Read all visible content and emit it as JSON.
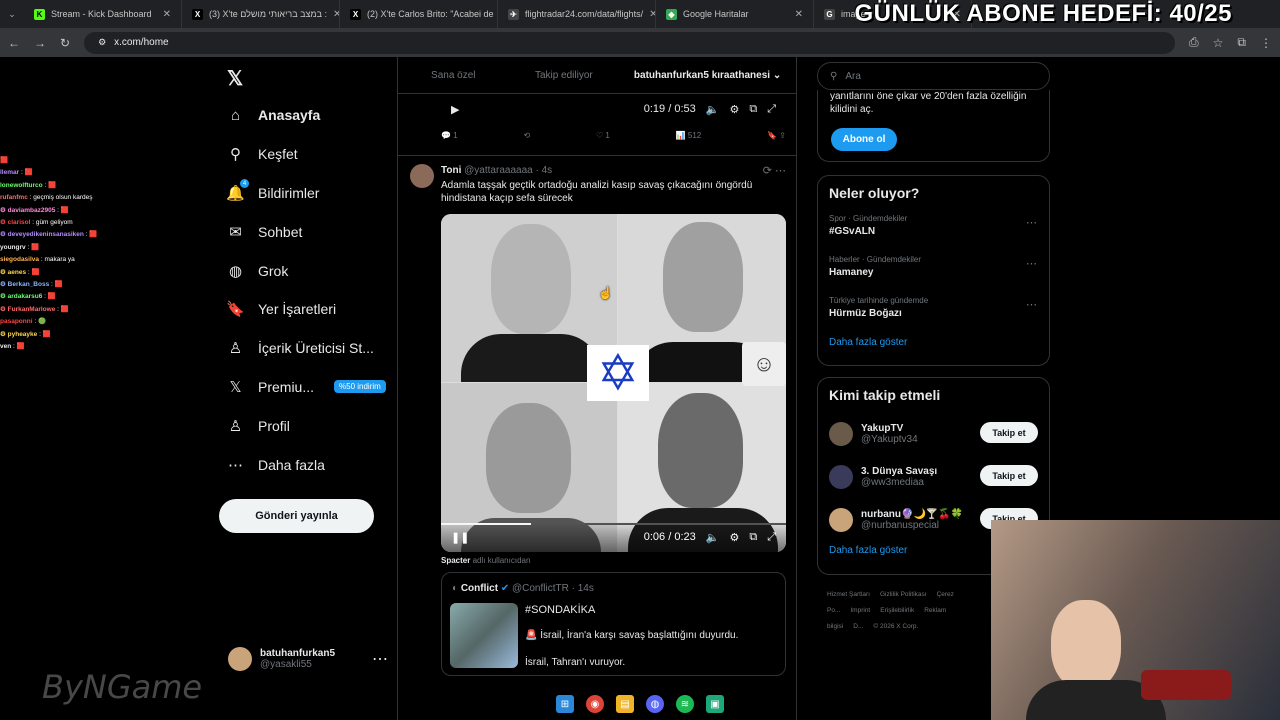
{
  "tabs": [
    {
      "title": "Stream - Kick Dashboard",
      "fav": "K",
      "color": "#53fc18"
    },
    {
      "title": "(3) X'te במצב בריאותי מושלם :",
      "fav": "X",
      "color": "#000"
    },
    {
      "title": "(2) X'te Carlos Brito: \"Acabei de",
      "fav": "X",
      "color": "#000"
    },
    {
      "title": "flightradar24.com/data/flights/",
      "fav": "✈",
      "color": "#444"
    },
    {
      "title": "Google Haritalar",
      "fav": "◆",
      "color": "#34a853"
    },
    {
      "title": "image",
      "fav": "G",
      "color": "#444"
    }
  ],
  "address": {
    "url": "x.com/home"
  },
  "overlay": "GÜNLÜK ABONE HEDEFİ: 40/25",
  "chat": [
    {
      "user": "",
      "msg": "🟥",
      "color": "#ff6a6a"
    },
    {
      "user": "llemar",
      "msg": ": 🟥",
      "color": "#b08cff"
    },
    {
      "user": "lonewolfturco",
      "msg": ": 🟥",
      "color": "#6aff6a"
    },
    {
      "user": "rufanfmc",
      "msg": ": geçmiş olsun kardeş",
      "color": "#ff6a6a"
    },
    {
      "user": "⚙ daviambaz2905",
      "msg": ": 🟥",
      "color": "#ff8ad8"
    },
    {
      "user": "⚙ clarisol",
      "msg": ": güm geliyom",
      "color": "#ff4444"
    },
    {
      "user": "⚙ deveyedikeninsanasiken",
      "msg": ": 🟥",
      "color": "#b08cff"
    },
    {
      "user": "youngrv",
      "msg": ": 🟥",
      "color": "#e7e9ea"
    },
    {
      "user": "siegodasilva",
      "msg": ": makara ya",
      "color": "#ffb34d"
    },
    {
      "user": "⚙ aenes",
      "msg": ": 🟥",
      "color": "#ffd84d"
    },
    {
      "user": "⚙ Berkan_Boss",
      "msg": ": 🟥",
      "color": "#8ab4ff"
    },
    {
      "user": "⚙ ardakarsu6",
      "msg": ": 🟥",
      "color": "#6aff6a"
    },
    {
      "user": "⚙ FurkanMarlowe",
      "msg": ": 🟥",
      "color": "#ff6a6a"
    },
    {
      "user": "pasaponni",
      "msg": ": 🟢",
      "color": "#ff4444"
    },
    {
      "user": "⚙ pyheayke",
      "msg": ": 🟥",
      "color": "#ffd84d"
    },
    {
      "user": "ven",
      "msg": ": 🟥",
      "color": "#e7e9ea"
    }
  ],
  "nav": [
    {
      "label": "Anasayfa",
      "icon": "home-icon",
      "glyph": "⌂"
    },
    {
      "label": "Keşfet",
      "icon": "search-icon",
      "glyph": "⚲"
    },
    {
      "label": "Bildirimler",
      "icon": "bell-icon",
      "glyph": "🔔"
    },
    {
      "label": "Sohbet",
      "icon": "mail-icon",
      "glyph": "✉"
    },
    {
      "label": "Grok",
      "icon": "grok-icon",
      "glyph": "◍"
    },
    {
      "label": "Yer İşaretleri",
      "icon": "bookmark-icon",
      "glyph": "🔖"
    },
    {
      "label": "İçerik Üreticisi St...",
      "icon": "creator-icon",
      "glyph": "♙"
    },
    {
      "label": "Premiu...",
      "icon": "x-logo-icon",
      "glyph": "𝕏"
    },
    {
      "label": "Profil",
      "icon": "profile-icon",
      "glyph": "♙"
    },
    {
      "label": "Daha fazla",
      "icon": "more-icon",
      "glyph": "⋯"
    }
  ],
  "premium_badge": "%50 indirim",
  "notif_count": "4",
  "post_button": "Gönderi yayınla",
  "profile": {
    "name": "batuhanfurkan5",
    "handle": "@yasakli55"
  },
  "feed_tabs": [
    "Sana özel",
    "Takip ediliyor",
    "batuhanfurkan5 kıraathanesi"
  ],
  "video1": {
    "time": "0:19 / 0:53"
  },
  "actions1": {
    "replies": "1",
    "retweets": "",
    "likes": "1",
    "views": "512"
  },
  "tweet": {
    "name": "Toni",
    "handle": "@yattaraaaaaa · 4s",
    "text": "Adamla taşşak geçtik ortadoğu analizi kasıp savaş çıkacağını öngördü hindistana kaçıp sefa sürecek",
    "video_time": "0:06 / 0:23"
  },
  "spacer": {
    "name": "Spacter",
    "rest": "adlı kullanıcıdan"
  },
  "quote": {
    "name": "Conflict",
    "handle": "@ConflictTR · 14s",
    "hashtag": "#SONDAKİKA",
    "line1": "🚨 İsrail, İran'a karşı savaş başlattığını duyurdu.",
    "line2": "İsrail, Tahran'ı vuruyor."
  },
  "search": {
    "placeholder": "Ara"
  },
  "premium_card": {
    "text": "yanıtlarını öne çıkar ve 20'den fazla özelliğin kilidini aç.",
    "button": "Abone ol"
  },
  "trends": {
    "title": "Neler oluyor?",
    "items": [
      {
        "context": "Spor · Gündemdekiler",
        "name": "#GSvALN"
      },
      {
        "context": "Haberler · Gündemdekiler",
        "name": "Hamaney"
      },
      {
        "context": "Türkiye tarihinde gündemde",
        "name": "Hürmüz Boğazı"
      }
    ],
    "more": "Daha fazla göster"
  },
  "who_to_follow": {
    "title": "Kimi takip etmeli",
    "items": [
      {
        "name": "YakupTV",
        "handle": "@Yakuptv34",
        "button": "Takip et"
      },
      {
        "name": "3. Dünya Savaşı",
        "handle": "@ww3mediaa",
        "button": "Takip et"
      },
      {
        "name": "nurbanu🔮🌙🍸🍒🍀",
        "handle": "@nurbanuspecial",
        "button": "Takip et"
      }
    ],
    "more": "Daha fazla göster"
  },
  "footer": [
    "Hizmet Şartları",
    "Gizlilik Politikası",
    "Çerez Po...",
    "Imprint",
    "Erişilebilirlik",
    "Reklam bilgisi",
    "D...",
    "© 2026 X Corp."
  ],
  "watermark": "ByNGame"
}
